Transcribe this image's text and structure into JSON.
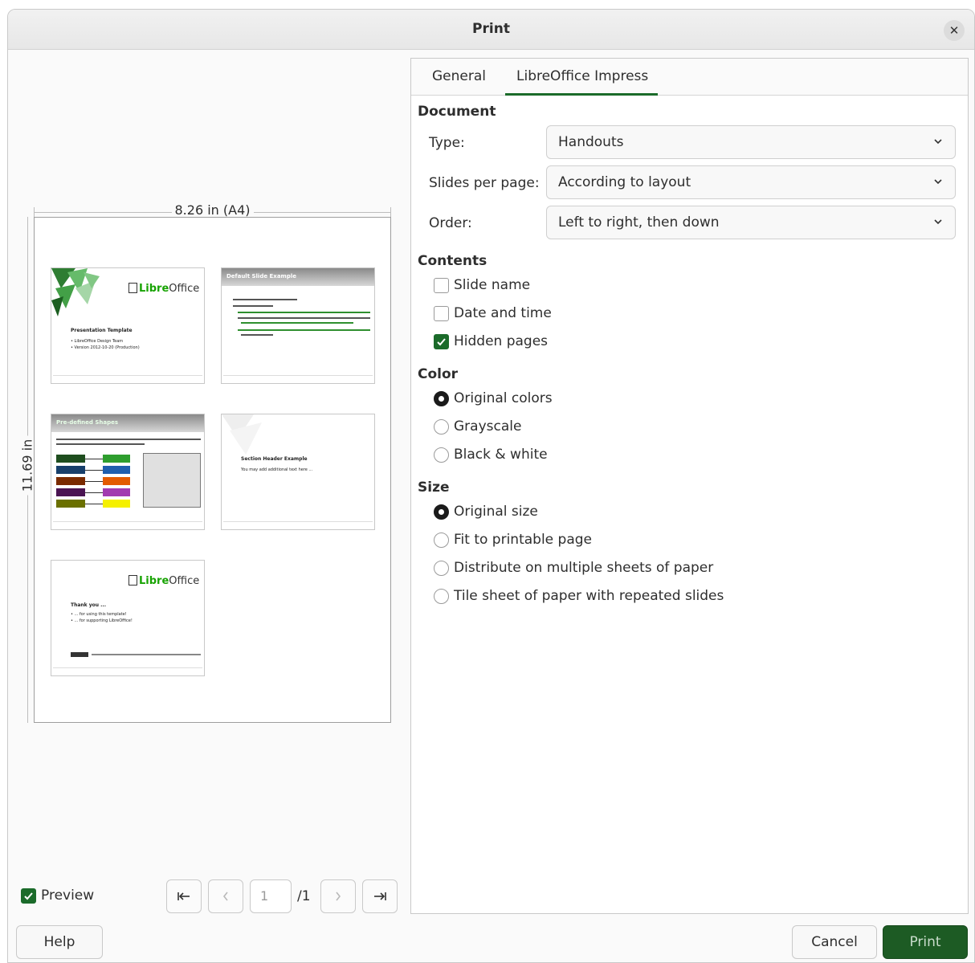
{
  "window": {
    "title": "Print"
  },
  "preview": {
    "width_label": "8.26 in (A4)",
    "height_label": "11.69 in",
    "slides": [
      {
        "kind": "title",
        "logo_libre": "Libre",
        "logo_office": "Office",
        "heading": "Presentation Template",
        "bullets": [
          "• LibreOffice Design Team",
          "• Version 2012-10-20 (Production)"
        ]
      },
      {
        "kind": "content",
        "title": "Default Slide Example"
      },
      {
        "kind": "shapes",
        "title": "Pre-defined Shapes",
        "note": "Here are some pre-defined shapes for your convenience: copy the shapes, copy their formatting, or use the LibO styles.",
        "buttons": [
          "Green Dark",
          "Blue Dark",
          "Orange Dark",
          "Purple Dark",
          "Yellow Dark"
        ],
        "buttons_light": [
          "Green Bright",
          "Blue Bright",
          "Orange Bright",
          "Purple Bright",
          "Yellow Bright"
        ]
      },
      {
        "kind": "section",
        "heading": "Section Header Example",
        "sub": "You may add additional text here ..."
      },
      {
        "kind": "thanks",
        "logo_libre": "Libre",
        "logo_office": "Office",
        "heading": "Thank you ...",
        "bullets": [
          "• ... for using this template!",
          "• ... for supporting LibreOffice!"
        ]
      }
    ]
  },
  "tabs": [
    {
      "label": "General",
      "active": false
    },
    {
      "label": "LibreOffice Impress",
      "active": true
    }
  ],
  "document": {
    "heading": "Document",
    "type_label": "Type:",
    "type_value": "Handouts",
    "slides_per_page_label": "Slides per page:",
    "slides_per_page_value": "According to layout",
    "order_label": "Order:",
    "order_value": "Left to right, then down"
  },
  "contents": {
    "heading": "Contents",
    "options": [
      {
        "label": "Slide name",
        "checked": false
      },
      {
        "label": "Date and time",
        "checked": false
      },
      {
        "label": "Hidden pages",
        "checked": true
      }
    ]
  },
  "color": {
    "heading": "Color",
    "options": [
      {
        "label": "Original colors",
        "checked": true
      },
      {
        "label": "Grayscale",
        "checked": false
      },
      {
        "label": "Black & white",
        "checked": false
      }
    ]
  },
  "size": {
    "heading": "Size",
    "options": [
      {
        "label": "Original size",
        "checked": true
      },
      {
        "label": "Fit to printable page",
        "checked": false
      },
      {
        "label": "Distribute on multiple sheets of paper",
        "checked": false
      },
      {
        "label": "Tile sheet of paper with repeated slides",
        "checked": false
      }
    ]
  },
  "footer": {
    "preview_label": "Preview",
    "preview_checked": true,
    "page_value": "1",
    "page_count": "/1",
    "help_label": "Help",
    "cancel_label": "Cancel",
    "print_label": "Print"
  },
  "colors": {
    "accent": "#1b6b2a",
    "primary_button": "#1d5b24",
    "libre_green": "#18a303"
  }
}
